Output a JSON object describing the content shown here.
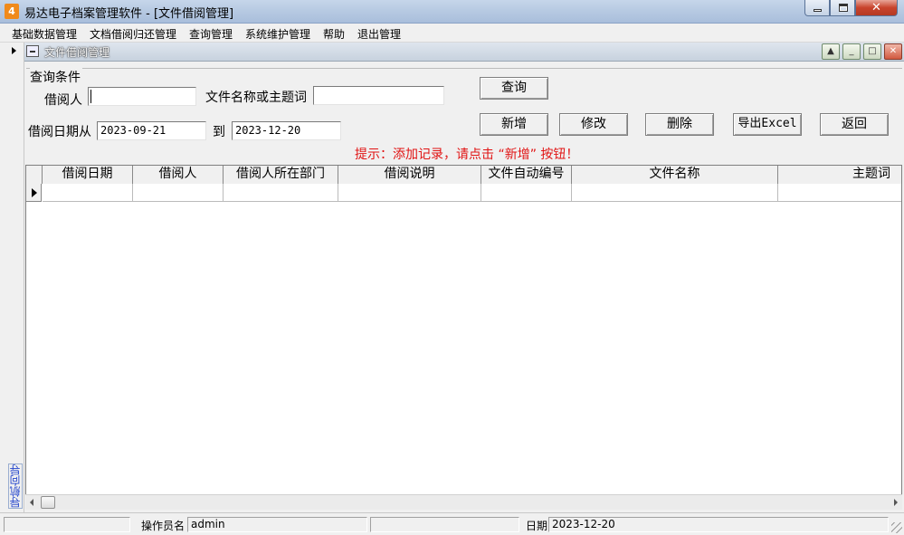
{
  "window": {
    "app_icon_text": "4",
    "title": "易达电子档案管理软件  - [文件借阅管理]",
    "close_symbol": "✕"
  },
  "menu": [
    "基础数据管理",
    "文档借阅归还管理",
    "查询管理",
    "系统维护管理",
    "帮助",
    "退出管理"
  ],
  "nav": {
    "label": "导航向导"
  },
  "child": {
    "title": "文件借阅管理",
    "controls": [
      "▲",
      "_",
      "□",
      "✕"
    ]
  },
  "query": {
    "group_title": "查询条件",
    "borrower_label": "借阅人",
    "borrower_value": "",
    "filename_label": "文件名称或主题词",
    "filename_value": "",
    "date_from_label": "借阅日期从",
    "date_from": "2023-09-21",
    "date_to_label": "到",
    "date_to": "2023-12-20"
  },
  "buttons": {
    "query": "查询",
    "add": "新增",
    "edit": "修改",
    "delete": "删除",
    "export": "导出Excel",
    "back": "返回"
  },
  "hint": "提示：添加记录，请点击 “新增” 按钮！",
  "grid": {
    "columns": [
      "借阅日期",
      "借阅人",
      "借阅人所在部门",
      "借阅说明",
      "文件自动编号",
      "文件名称",
      "主题词"
    ],
    "rows": []
  },
  "status": {
    "operator_label": "操作员名",
    "operator_value": "admin",
    "date_label": "日期",
    "date_value": "2023-12-20"
  }
}
